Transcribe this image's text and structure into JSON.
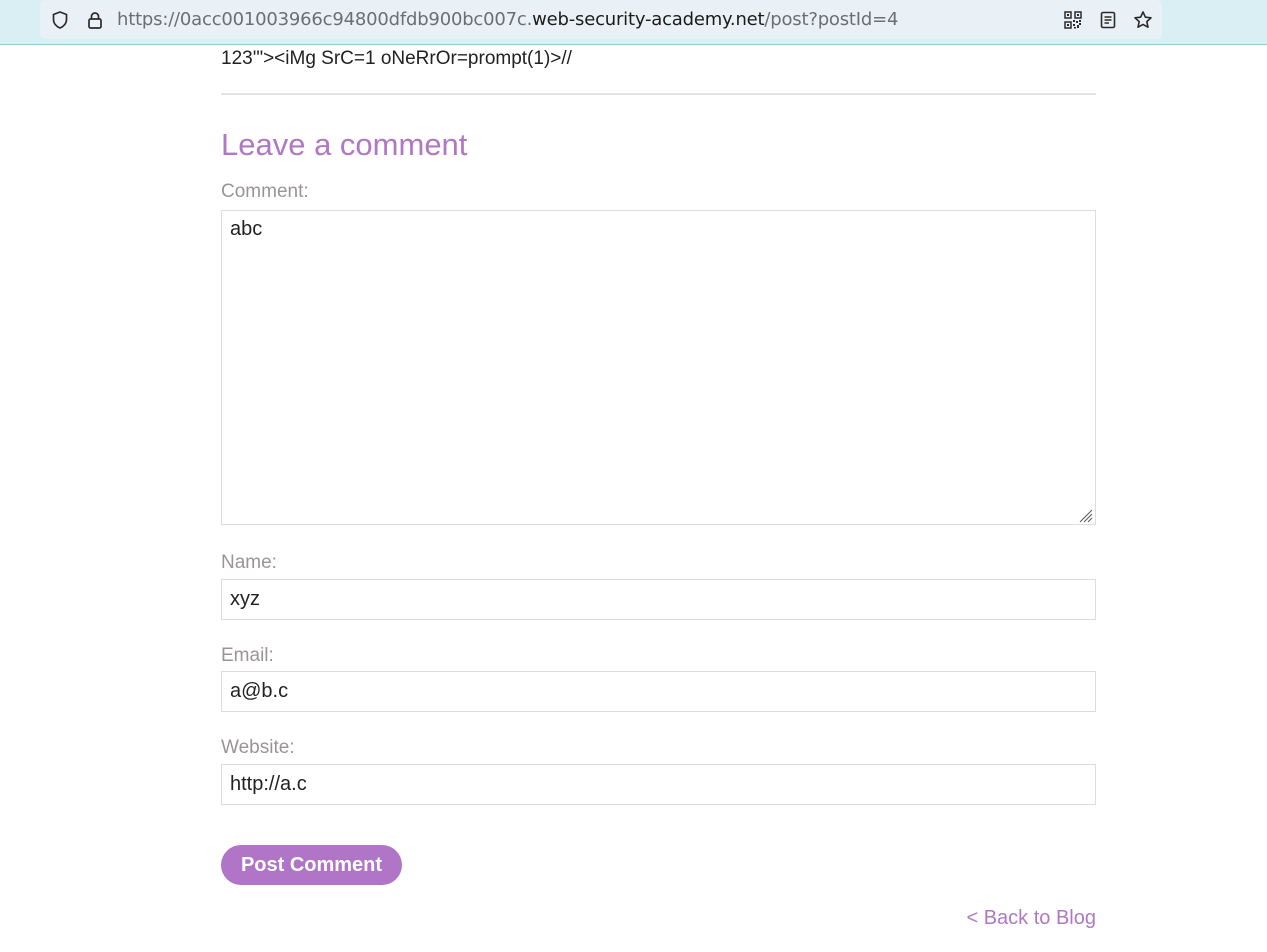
{
  "browser": {
    "url_prefix": "https://0acc001003966c94800dfdb900bc007c.",
    "url_host": "web-security-academy.net",
    "url_path": "/post?postId=4"
  },
  "page": {
    "previous_comment": "123'\"><iMg SrC=1 oNeRrOr=prompt(1)>//",
    "section_title": "Leave a comment",
    "comment_label": "Comment:",
    "comment_value": "abc",
    "name_label": "Name:",
    "name_value": "xyz",
    "email_label": "Email:",
    "email_value": "a@b.c",
    "website_label": "Website:",
    "website_value": "http://a.c",
    "post_button": "Post Comment",
    "back_link": "< Back to Blog"
  },
  "colors": {
    "accent": "#b075c6",
    "label": "#999595",
    "browser_bar": "#d9eff3"
  },
  "icons": {
    "shield": "shield-icon",
    "lock": "lock-icon",
    "qr": "qr-code-icon",
    "reader": "reader-view-icon",
    "star": "bookmark-star-icon"
  }
}
